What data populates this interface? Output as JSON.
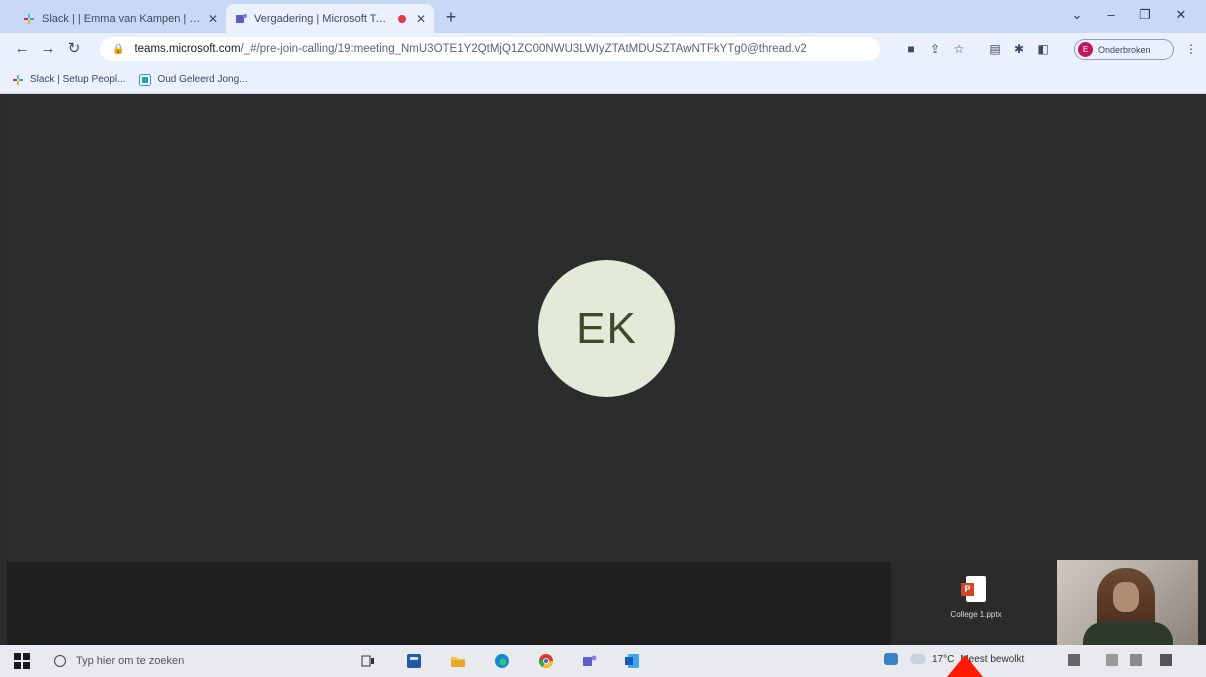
{
  "browser": {
    "tabs": [
      {
        "label": "Slack | | Emma van Kampen | O...",
        "active": false
      },
      {
        "label": "Vergadering | Microsoft Tea...",
        "active": true,
        "recording": true
      }
    ],
    "new_tab": "+",
    "window_controls": {
      "dropdown": "⌄",
      "minimize": "–",
      "restore": "❐",
      "close": "✕"
    },
    "address_bar": {
      "domain": "teams.microsoft.com",
      "path": "/_#/pre-join-calling/19:meeting_NmU3OTE1Y2QtMjQ1ZC00NWU3LWIyZTAtMDUSZTAwNTFkYTg0@thread.v2"
    },
    "profile_button": {
      "initial": "E",
      "label": "Onderbroken"
    },
    "bookmarks": [
      {
        "label": "Slack | Setup Peopl..."
      },
      {
        "label": "Oud Geleerd Jong..."
      }
    ]
  },
  "teams": {
    "participant_initials": "EK",
    "download": {
      "filename": "College 1.pptx",
      "icon_letter": "P"
    }
  },
  "taskbar": {
    "search_placeholder": "Typ hier om te zoeken",
    "weather": {
      "temperature": "17°C",
      "condition": "Meest bewolkt"
    }
  },
  "colors": {
    "stage_bg": "#2d2c2c",
    "avatar_bg": "#e3ead7",
    "avatar_text": "#3f4a2d",
    "annotation_arrow": "#ff1a00"
  }
}
